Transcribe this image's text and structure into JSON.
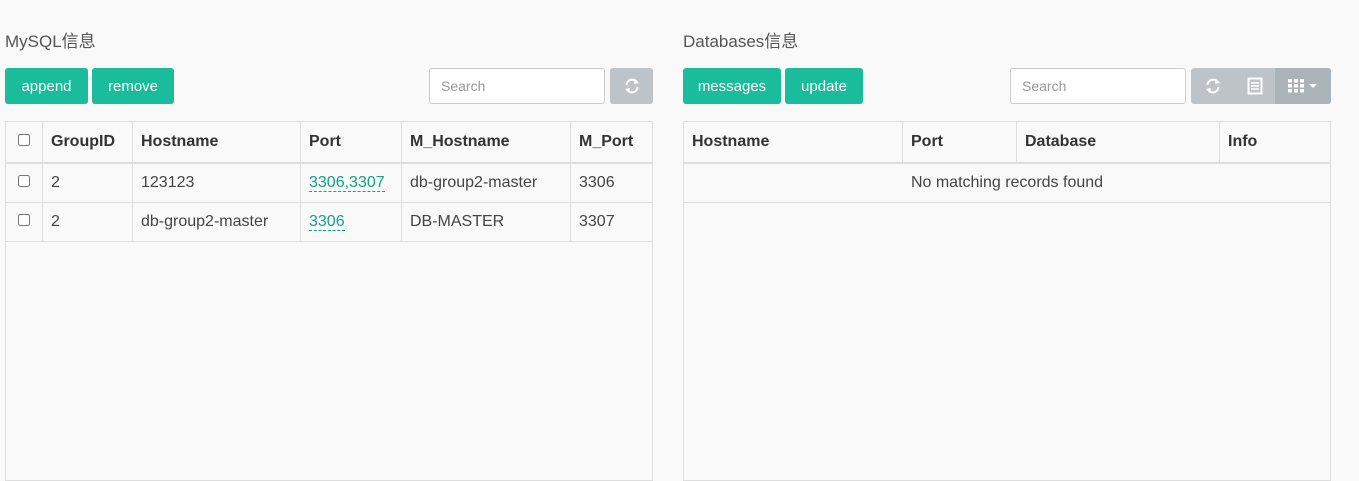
{
  "left": {
    "title": "MySQL信息",
    "append_label": "append",
    "remove_label": "remove",
    "search_placeholder": "Search",
    "columns": [
      "GroupID",
      "Hostname",
      "Port",
      "M_Hostname",
      "M_Port"
    ],
    "rows": [
      {
        "group_id": "2",
        "hostname": "123123",
        "port": "3306,3307",
        "m_hostname": "db-group2-master",
        "m_port": "3306"
      },
      {
        "group_id": "2",
        "hostname": "db-group2-master",
        "port": "3306",
        "m_hostname": "DB-MASTER",
        "m_port": "3307"
      }
    ]
  },
  "right": {
    "title": "Databases信息",
    "messages_label": "messages",
    "update_label": "update",
    "search_placeholder": "Search",
    "columns": [
      "Hostname",
      "Port",
      "Database",
      "Info"
    ],
    "empty_text": "No matching records found"
  },
  "icons": {
    "refresh": "refresh-icon",
    "list": "list-icon",
    "columns": "grid-icon",
    "caret": "caret-down-icon"
  },
  "colors": {
    "primary": "#1abc9c",
    "secondary": "#bdc3c7",
    "link": "#16a085"
  }
}
